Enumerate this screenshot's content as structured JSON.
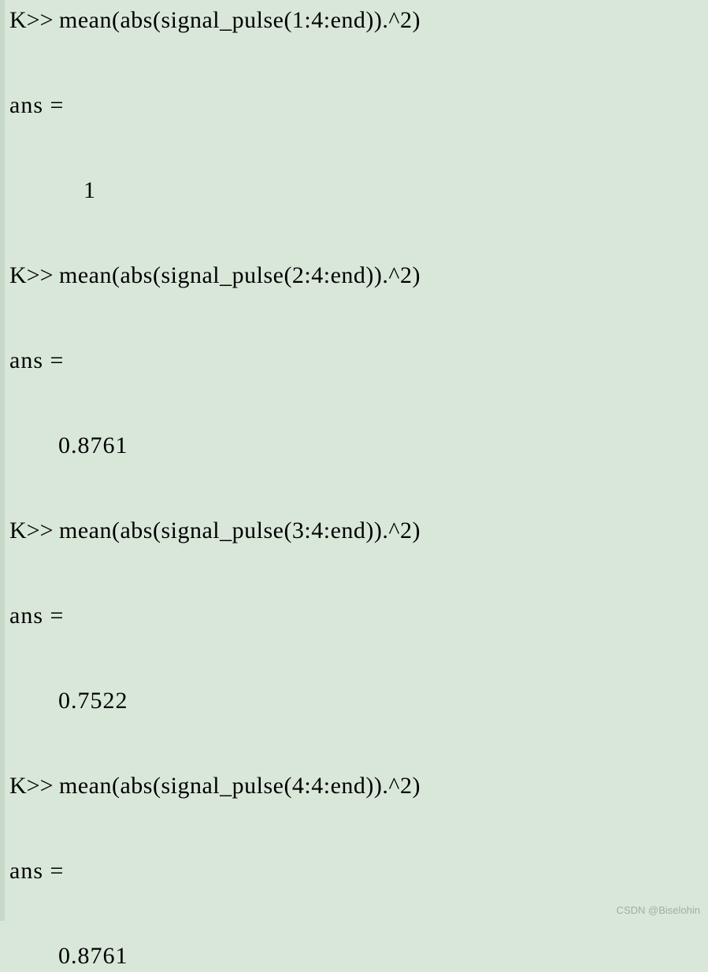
{
  "prompt": "K>> ",
  "ans_label": "ans =",
  "commands": [
    "mean(abs(signal_pulse(1:4:end)).^2)",
    "mean(abs(signal_pulse(2:4:end)).^2)",
    "mean(abs(signal_pulse(3:4:end)).^2)",
    "mean(abs(signal_pulse(4:4:end)).^2)"
  ],
  "results": [
    "1",
    "0.8761",
    "0.7522",
    "0.8761"
  ],
  "watermark": "CSDN @Biselohin"
}
